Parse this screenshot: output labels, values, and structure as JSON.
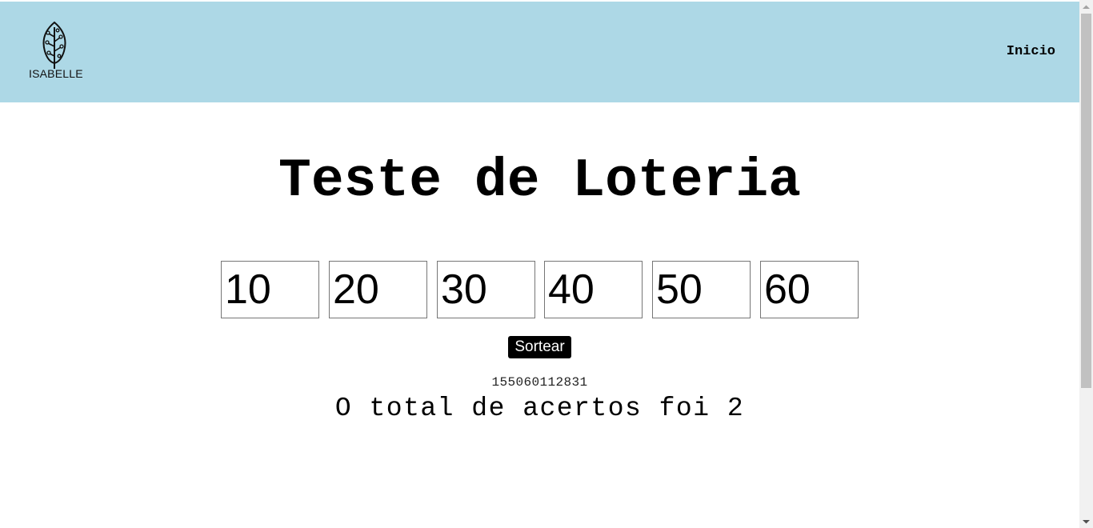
{
  "header": {
    "logo_text": "ISABELLE",
    "nav_link": "Inicio",
    "background": "#add8e6"
  },
  "main": {
    "title": "Teste de Loteria",
    "numbers": [
      "10",
      "20",
      "30",
      "40",
      "50",
      "60"
    ],
    "draw_button": "Sortear",
    "drawn_numbers": "155060112831",
    "result_text": "O total de acertos foi 2"
  },
  "icons": {
    "logo": "tree-leaf-icon",
    "scroll_up": "scroll-up-arrow-icon",
    "scroll_down": "scroll-down-arrow-icon"
  }
}
